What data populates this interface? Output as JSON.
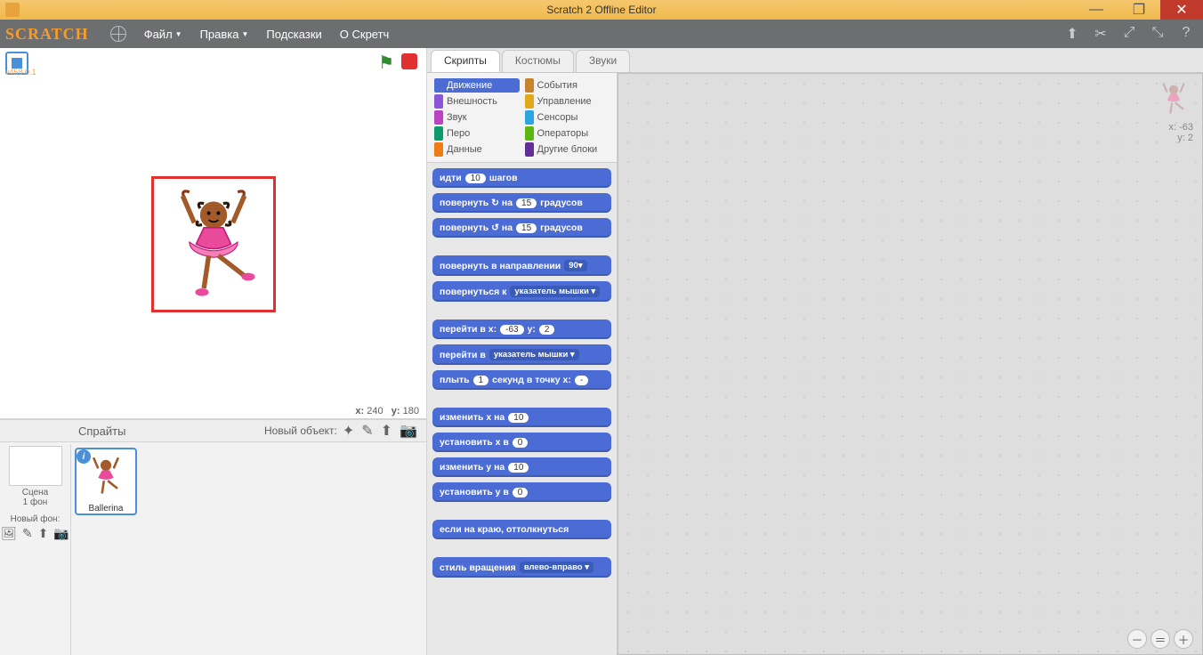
{
  "window": {
    "title": "Scratch 2 Offline Editor"
  },
  "menu": {
    "file": "Файл",
    "edit": "Правка",
    "tips": "Подсказки",
    "about": "О Скретч"
  },
  "stage": {
    "version": "v458.0.1",
    "coords_x_label": "x:",
    "coords_x": "240",
    "coords_y_label": "y:",
    "coords_y": "180"
  },
  "sprites": {
    "panel_title": "Спрайты",
    "new_object": "Новый объект:",
    "stage_label": "Сцена",
    "backdrops_label": "1 фон",
    "new_bg_label": "Новый фон:",
    "selected_name": "Ballerina"
  },
  "tabs": {
    "scripts": "Скрипты",
    "costumes": "Костюмы",
    "sounds": "Звуки"
  },
  "categories": {
    "motion": "Движение",
    "looks": "Внешность",
    "sound": "Звук",
    "pen": "Перо",
    "data": "Данные",
    "events": "События",
    "control": "Управление",
    "sensing": "Сенсоры",
    "operators": "Операторы",
    "more": "Другие блоки"
  },
  "cat_colors": {
    "motion": "#4a6cd4",
    "looks": "#8a55d7",
    "sound": "#bb42c3",
    "pen": "#0e9a6c",
    "data": "#ee7d16",
    "events": "#c88330",
    "control": "#e1a91a",
    "sensing": "#2ca5e2",
    "operators": "#5cb712",
    "more": "#632d99"
  },
  "blocks": [
    {
      "t": "идти",
      "n": "10",
      "t2": "шагов"
    },
    {
      "t": "повернуть ↻ на",
      "n": "15",
      "t2": "градусов"
    },
    {
      "t": "повернуть ↺ на",
      "n": "15",
      "t2": "градусов"
    },
    {
      "gap": true
    },
    {
      "t": "повернуть в направлении",
      "dd": "90▾"
    },
    {
      "t": "повернуться к",
      "dd": "указатель мышки ▾"
    },
    {
      "gap": true
    },
    {
      "t": "перейти в x:",
      "n": "-63",
      "t2": "y:",
      "n2": "2"
    },
    {
      "t": "перейти в",
      "dd": "указатель мышки ▾"
    },
    {
      "t": "плыть",
      "n": "1",
      "t2": "секунд в точку x:",
      "n2": "-"
    },
    {
      "gap": true
    },
    {
      "t": "изменить x на",
      "n": "10"
    },
    {
      "t": "установить x в",
      "n": "0"
    },
    {
      "t": "изменить y на",
      "n": "10"
    },
    {
      "t": "установить y в",
      "n": "0"
    },
    {
      "gap": true
    },
    {
      "t": "если на краю, оттолкнуться"
    },
    {
      "gap": true
    },
    {
      "t": "стиль вращения",
      "dd": "влево-вправо ▾"
    }
  ],
  "script_area": {
    "x_label": "x:",
    "x": "-63",
    "y_label": "y:",
    "y": "2"
  }
}
